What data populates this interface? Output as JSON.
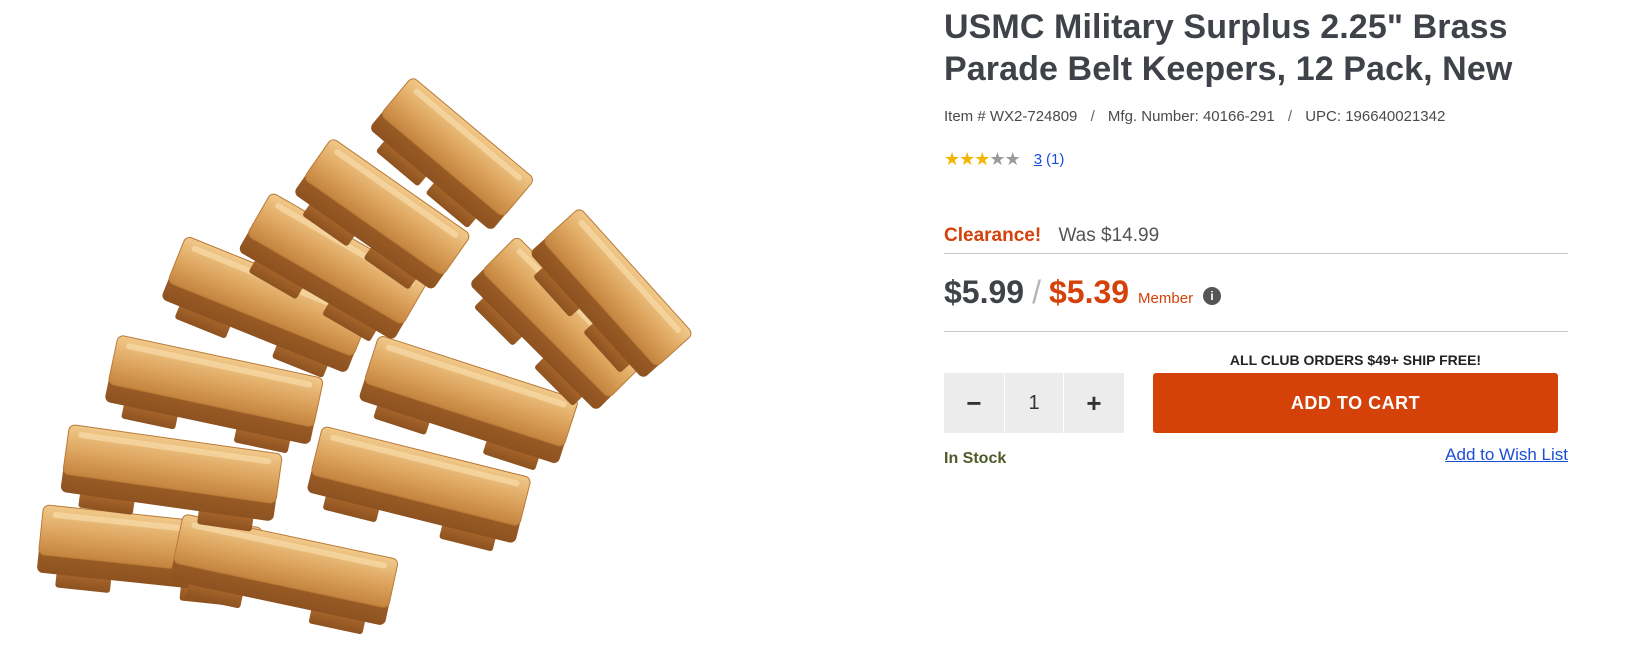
{
  "product": {
    "title": "USMC Military Surplus 2.25\" Brass Parade Belt Keepers, 12 Pack, New",
    "image_alt": "Brass parade belt keepers"
  },
  "meta": {
    "item": "Item # WX2-724809",
    "mfg": "Mfg. Number: 40166-291",
    "upc": "UPC: 196640021342",
    "separator": "/"
  },
  "rating": {
    "stars_filled": 3,
    "stars_total": 5,
    "score": "3",
    "count": "(1)"
  },
  "pricing": {
    "clearance_label": "Clearance!",
    "was": "Was $14.99",
    "regular": "$5.99",
    "slash": "/",
    "member_price": "$5.39",
    "member_label": "Member",
    "info_icon": "i"
  },
  "cart": {
    "shipping_note": "ALL CLUB ORDERS $49+ SHIP FREE!",
    "quantity": "1",
    "minus": "−",
    "plus": "+",
    "add_to_cart": "ADD TO CART",
    "stock_status": "In Stock",
    "wishlist": "Add to Wish List"
  },
  "colors": {
    "accent": "#d4420a",
    "link": "#1a4fd6",
    "stock": "#4e5a28",
    "brass": "#d9a25a"
  }
}
